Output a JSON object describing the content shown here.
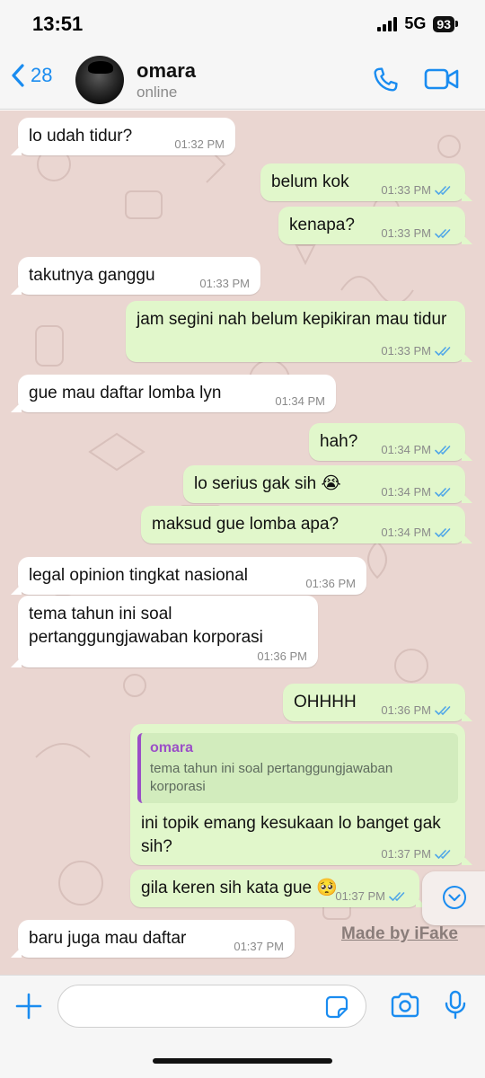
{
  "status_bar": {
    "time": "13:51",
    "network": "5G",
    "battery": "93"
  },
  "header": {
    "back_count": "28",
    "contact_name": "omara",
    "contact_status": "online"
  },
  "messages": [
    {
      "dir": "in",
      "text": "lo udah tidur?",
      "time": "01:32 PM"
    },
    {
      "dir": "out",
      "text": "belum kok",
      "time": "01:33 PM"
    },
    {
      "dir": "out",
      "text": "kenapa?",
      "time": "01:33 PM"
    },
    {
      "dir": "in",
      "text": "takutnya ganggu",
      "time": "01:33 PM"
    },
    {
      "dir": "out",
      "text": "jam segini nah belum kepikiran mau tidur",
      "time": "01:33 PM"
    },
    {
      "dir": "in",
      "text": "gue mau daftar lomba lyn",
      "time": "01:34 PM"
    },
    {
      "dir": "out",
      "text": "hah?",
      "time": "01:34 PM"
    },
    {
      "dir": "out",
      "text": "lo serius gak sih 😭",
      "time": "01:34 PM"
    },
    {
      "dir": "out",
      "text": "maksud gue lomba apa?",
      "time": "01:34 PM"
    },
    {
      "dir": "in",
      "text": "legal opinion tingkat nasional",
      "time": "01:36 PM"
    },
    {
      "dir": "in",
      "text": "tema tahun ini soal pertanggungjawaban korporasi",
      "time": "01:36 PM"
    },
    {
      "dir": "out",
      "text": "OHHHH",
      "time": "01:36 PM"
    },
    {
      "dir": "out",
      "quote_name": "omara",
      "quote_text": "tema tahun ini soal pertanggungjawaban korporasi",
      "text": "ini topik emang kesukaan lo banget gak sih?",
      "time": "01:37 PM"
    },
    {
      "dir": "out",
      "text": "gila keren sih kata gue 🥺",
      "time": "01:37 PM"
    },
    {
      "dir": "in",
      "text": "baru juga mau daftar",
      "time": "01:37 PM"
    }
  ],
  "watermark": "Made by iFake",
  "input": {
    "value": "",
    "placeholder": ""
  },
  "colors": {
    "accent": "#1a8cf0",
    "outgoing_bubble": "#e1f7cb",
    "incoming_bubble": "#ffffff",
    "wallpaper": "#ead6d1",
    "quote_author": "#9b4fc7",
    "read_ticks": "#4fa6e8"
  },
  "icons": {
    "back": "chevron-left-icon",
    "call": "phone-icon",
    "video": "video-camera-icon",
    "scroll": "chevron-down-circle-icon",
    "attach": "plus-icon",
    "sticker": "sticker-icon",
    "camera": "camera-icon",
    "mic": "microphone-icon"
  }
}
